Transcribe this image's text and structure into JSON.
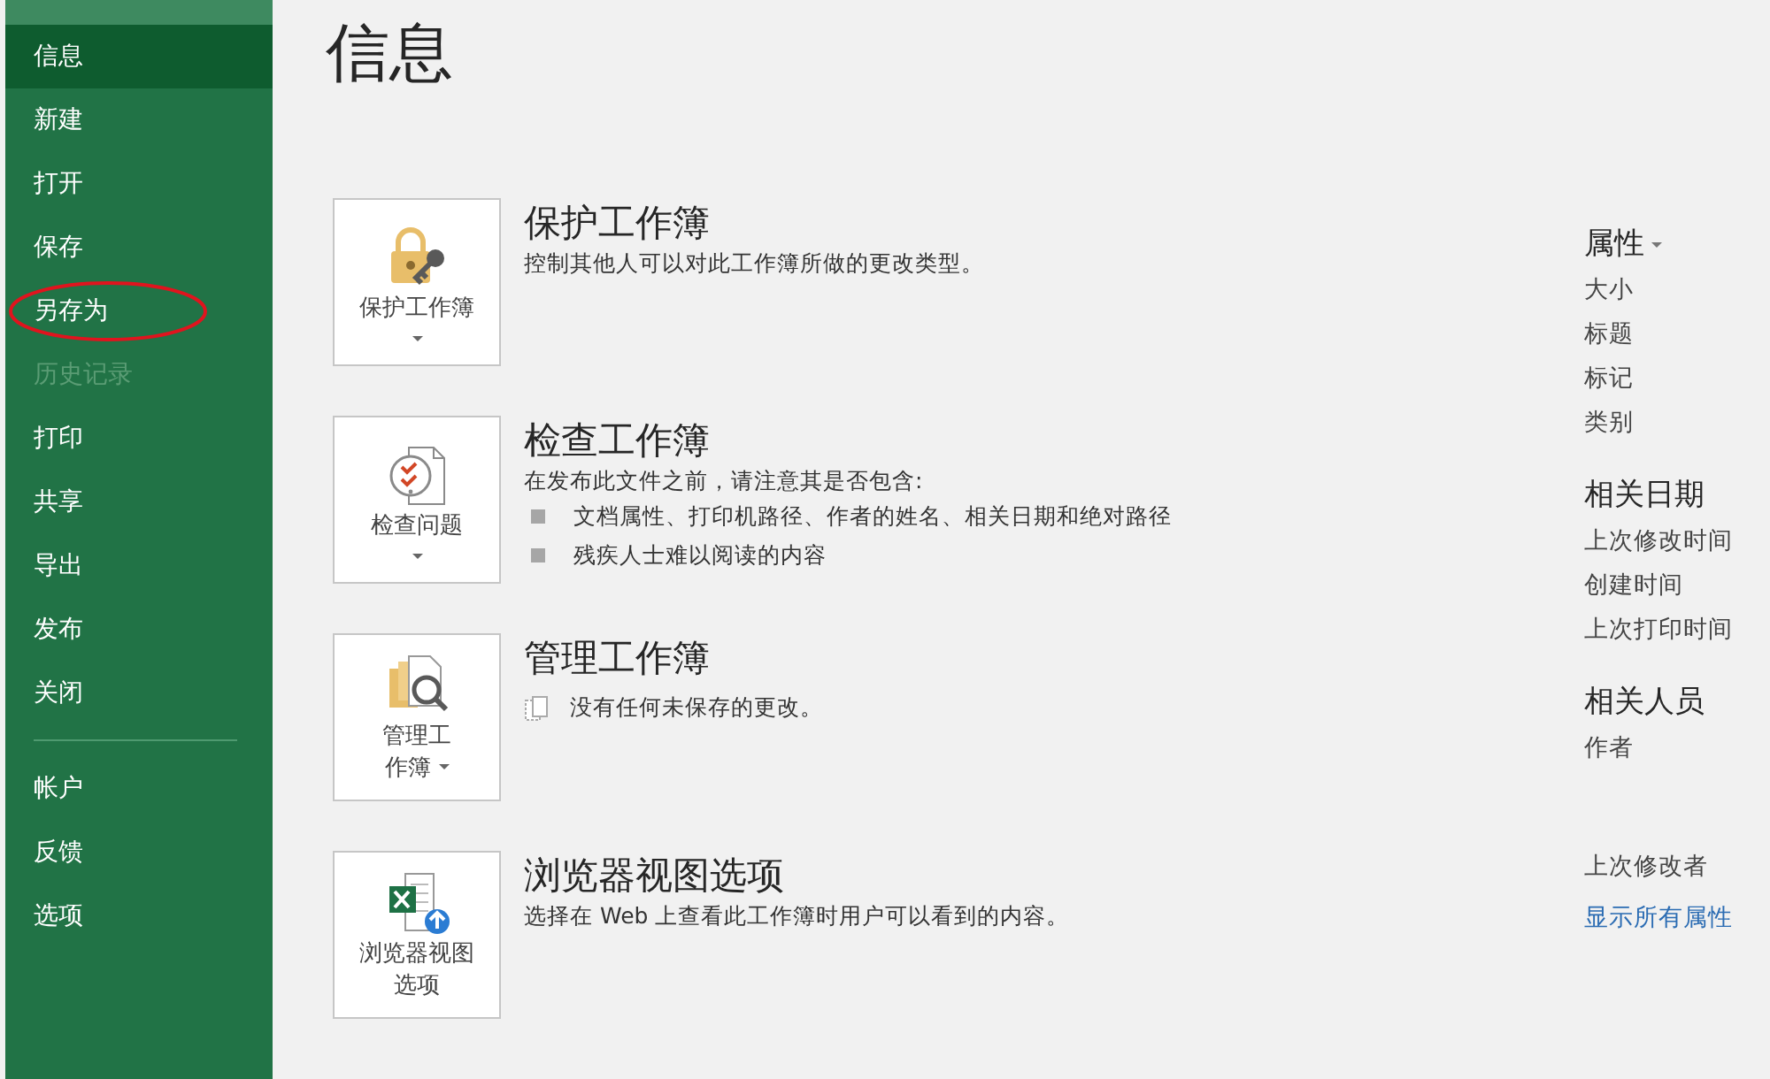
{
  "sidebar": {
    "items": [
      {
        "label": "信息",
        "selected": true,
        "disabled": false,
        "annotated": false
      },
      {
        "label": "新建",
        "selected": false,
        "disabled": false,
        "annotated": false
      },
      {
        "label": "打开",
        "selected": false,
        "disabled": false,
        "annotated": false
      },
      {
        "label": "保存",
        "selected": false,
        "disabled": false,
        "annotated": false
      },
      {
        "label": "另存为",
        "selected": false,
        "disabled": false,
        "annotated": true
      },
      {
        "label": "历史记录",
        "selected": false,
        "disabled": true,
        "annotated": false
      },
      {
        "label": "打印",
        "selected": false,
        "disabled": false,
        "annotated": false
      },
      {
        "label": "共享",
        "selected": false,
        "disabled": false,
        "annotated": false
      },
      {
        "label": "导出",
        "selected": false,
        "disabled": false,
        "annotated": false
      },
      {
        "label": "发布",
        "selected": false,
        "disabled": false,
        "annotated": false
      },
      {
        "label": "关闭",
        "selected": false,
        "disabled": false,
        "annotated": false
      }
    ],
    "footer_items": [
      {
        "label": "帐户",
        "selected": false,
        "disabled": false,
        "annotated": false
      },
      {
        "label": "反馈",
        "selected": false,
        "disabled": false,
        "annotated": false
      },
      {
        "label": "选项",
        "selected": false,
        "disabled": false,
        "annotated": false
      }
    ]
  },
  "page_title": "信息",
  "sections": [
    {
      "button_lines": [
        "保护工作簿"
      ],
      "dropdown": true,
      "title": "保护工作簿",
      "details": [
        {
          "kind": "text",
          "text": "控制其他人可以对此工作簿所做的更改类型。"
        }
      ]
    },
    {
      "button_lines": [
        "检查问题"
      ],
      "dropdown": true,
      "title": "检查工作簿",
      "details": [
        {
          "kind": "text",
          "text": "在发布此文件之前，请注意其是否包含:"
        },
        {
          "kind": "bullet",
          "text": "文档属性、打印机路径、作者的姓名、相关日期和绝对路径"
        },
        {
          "kind": "bullet",
          "text": "残疾人士难以阅读的内容"
        }
      ]
    },
    {
      "button_lines": [
        "管理工",
        "作簿"
      ],
      "dropdown": true,
      "title": "管理工作簿",
      "details": [
        {
          "kind": "note",
          "text": "没有任何未保存的更改。"
        }
      ]
    },
    {
      "button_lines": [
        "浏览器视图",
        "选项"
      ],
      "dropdown": false,
      "title": "浏览器视图选项",
      "details": [
        {
          "kind": "text",
          "text": "选择在 Web 上查看此工作簿时用户可以看到的内容。"
        }
      ]
    }
  ],
  "properties": {
    "groups": [
      {
        "heading": "属性",
        "caret": true,
        "items": [
          "大小",
          "标题",
          "标记",
          "类别"
        ]
      },
      {
        "heading": "相关日期",
        "caret": false,
        "items": [
          "上次修改时间",
          "创建时间",
          "上次打印时间"
        ]
      },
      {
        "heading": "相关人员",
        "caret": false,
        "items": [
          "作者"
        ]
      },
      {
        "items": [
          "上次修改者"
        ]
      }
    ],
    "link": "显示所有属性"
  }
}
